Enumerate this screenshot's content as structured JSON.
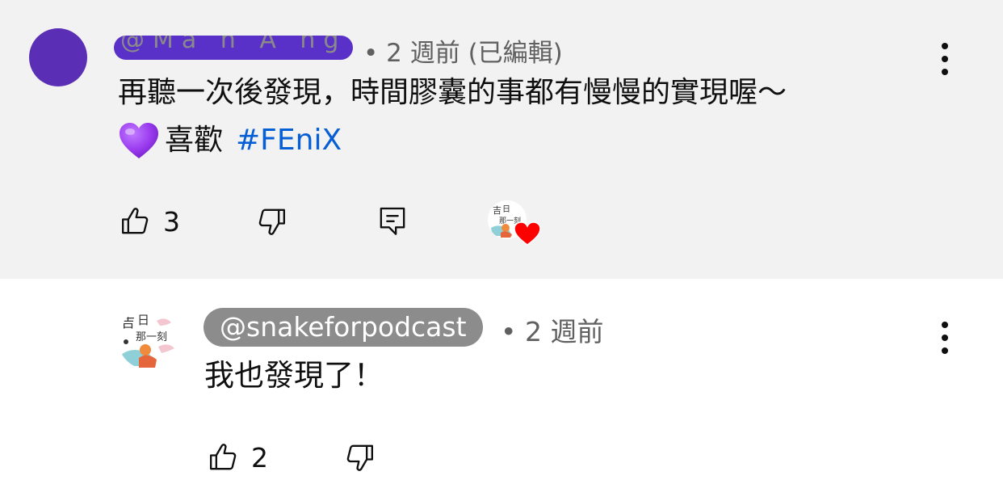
{
  "comment": {
    "author_redacted": "@Ma  h  A  ng  425",
    "dot": "•",
    "time": "2 週前 (已編輯)",
    "body_line1": "再聽一次後發現，時間膠囊的事都有慢慢的實現喔～",
    "body_line2_text": "喜歡",
    "hashtag": "#FEniX",
    "like_count": "3",
    "icons": [
      "thumbs-up-icon",
      "thumbs-down-icon",
      "reply-icon",
      "creator-heart-icon",
      "more-vert-icon",
      "purple-heart-emoji"
    ]
  },
  "reply": {
    "handle": "@snakeforpodcast",
    "dot": "•",
    "time": "2 週前",
    "body": "我也發現了！",
    "like_count": "2",
    "icons": [
      "thumbs-up-icon",
      "thumbs-down-icon",
      "more-vert-icon"
    ]
  },
  "colors": {
    "highlight_bg": "#f2f2f2",
    "avatar_purple": "#5a2fb5",
    "hashtag_blue": "#065fd4",
    "meta_gray": "#606060",
    "handle_pill_bg": "#8c8c8c",
    "heart_red": "#ff0000"
  }
}
